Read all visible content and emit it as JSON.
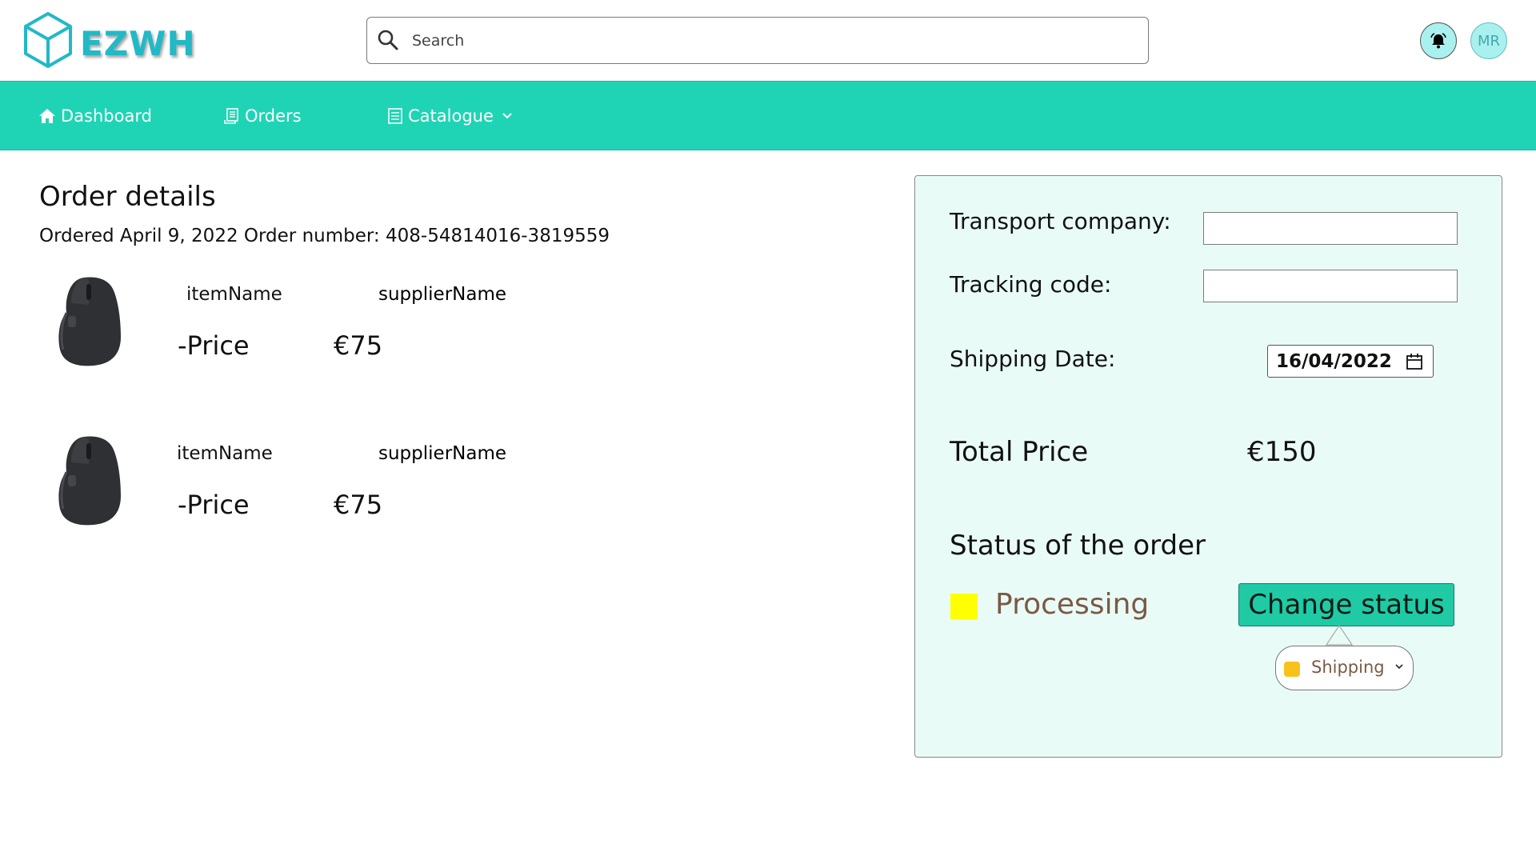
{
  "app": {
    "brand": "EZWH",
    "user_initials": "MR"
  },
  "search": {
    "placeholder": "Search"
  },
  "nav": {
    "items": [
      {
        "label": "Dashboard",
        "icon": "home-icon"
      },
      {
        "label": "Orders",
        "icon": "receipt-icon"
      },
      {
        "label": "Catalogue",
        "icon": "list-icon"
      }
    ]
  },
  "order": {
    "title": "Order details",
    "meta": "Ordered April 9, 2022 Order number: 408-54814016-3819559",
    "items": [
      {
        "item_name": "itemName",
        "supplier_name": "supplierName",
        "price_label": "-Price",
        "price": "€75"
      },
      {
        "item_name": "itemName",
        "supplier_name": "supplierName",
        "price_label": "-Price",
        "price": "€75"
      }
    ]
  },
  "panel": {
    "transport_label": "Transport company:",
    "transport_value": "",
    "tracking_label": "Tracking code:",
    "tracking_value": "",
    "shipping_date_label": "Shipping Date:",
    "shipping_date": "16/04/2022",
    "total_label": "Total Price",
    "total_value": "€150",
    "status_title": "Status of the order",
    "status": "Processing",
    "change_button": "Change status",
    "status_option": "Shipping"
  },
  "colors": {
    "nav_bg": "#1fd4b4",
    "brand": "#22b9c6",
    "panel_bg": "#e9fbf6",
    "status_processing": "#ffff00",
    "status_shipping": "#f8c21c",
    "button": "#1fcaa5"
  }
}
